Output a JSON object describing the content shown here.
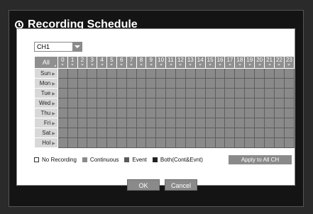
{
  "dialog": {
    "title": "Recording Schedule",
    "ok_label": "OK",
    "cancel_label": "Cancel"
  },
  "channel": {
    "selected": "CH1"
  },
  "schedule": {
    "all_label": "All",
    "hours": [
      "0",
      "1",
      "2",
      "3",
      "4",
      "5",
      "6",
      "7",
      "8",
      "9",
      "10",
      "11",
      "12",
      "13",
      "14",
      "15",
      "16",
      "17",
      "18",
      "19",
      "20",
      "21",
      "22",
      "23"
    ],
    "days": [
      "Sun",
      "Mon",
      "Tue",
      "Wed",
      "Thu",
      "Fri",
      "Sat",
      "Hol"
    ]
  },
  "legend": {
    "items": [
      {
        "label": "No Recording",
        "color": "#ffffff"
      },
      {
        "label": "Continuous",
        "color": "#8a8a8a"
      },
      {
        "label": "Event",
        "color": "#5a5a5a"
      },
      {
        "label": "Both(Cont&Evnt)",
        "color": "#222222"
      }
    ],
    "apply_label": "Apply to All CH"
  },
  "colors": {
    "slot_fill": "#8a8a8a",
    "header_fill": "#8f8f8f",
    "day_fill": "#d8d8d8"
  }
}
